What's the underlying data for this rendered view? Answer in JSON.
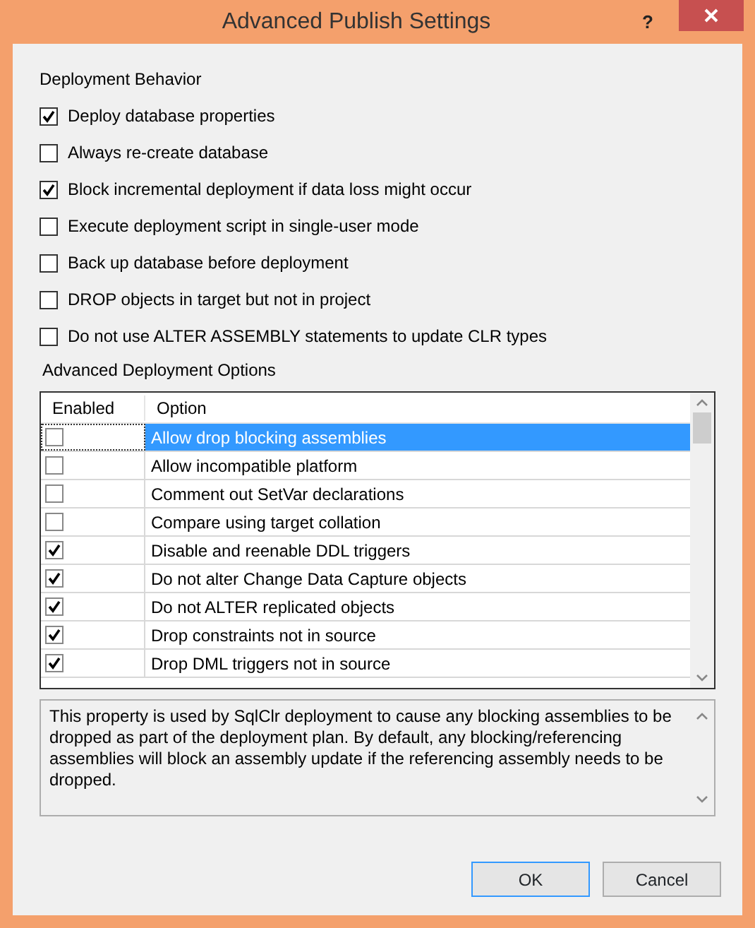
{
  "window": {
    "title": "Advanced Publish Settings",
    "help_button": "?"
  },
  "deployment_behavior": {
    "heading": "Deployment Behavior",
    "options": [
      {
        "label": "Deploy database properties",
        "checked": true
      },
      {
        "label": "Always re-create database",
        "checked": false
      },
      {
        "label": "Block incremental deployment if data loss might occur",
        "checked": true
      },
      {
        "label": "Execute deployment script in single-user mode",
        "checked": false
      },
      {
        "label": "Back up database before deployment",
        "checked": false
      },
      {
        "label": "DROP objects in target but not in project",
        "checked": false
      },
      {
        "label": "Do not use ALTER ASSEMBLY statements to update CLR types",
        "checked": false
      }
    ]
  },
  "advanced_options": {
    "heading": "Advanced Deployment Options",
    "columns": [
      "Enabled",
      "Option"
    ],
    "rows": [
      {
        "option": "Allow drop blocking assemblies",
        "enabled": false,
        "selected": true
      },
      {
        "option": "Allow incompatible platform",
        "enabled": false,
        "selected": false
      },
      {
        "option": "Comment out SetVar declarations",
        "enabled": false,
        "selected": false
      },
      {
        "option": "Compare using target collation",
        "enabled": false,
        "selected": false
      },
      {
        "option": "Disable and reenable DDL triggers",
        "enabled": true,
        "selected": false
      },
      {
        "option": "Do not alter Change Data Capture objects",
        "enabled": true,
        "selected": false
      },
      {
        "option": "Do not ALTER replicated objects",
        "enabled": true,
        "selected": false
      },
      {
        "option": "Drop constraints not in source",
        "enabled": true,
        "selected": false
      },
      {
        "option": "Drop DML triggers not in source",
        "enabled": true,
        "selected": false
      }
    ]
  },
  "description": "This property is used by SqlClr deployment to cause any blocking assemblies to be dropped as part of the deployment plan. By default, any blocking/referencing assemblies will block an assembly update if the referencing assembly needs to be dropped.",
  "buttons": [
    {
      "label": "OK",
      "default": true
    },
    {
      "label": "Cancel",
      "default": false
    }
  ]
}
